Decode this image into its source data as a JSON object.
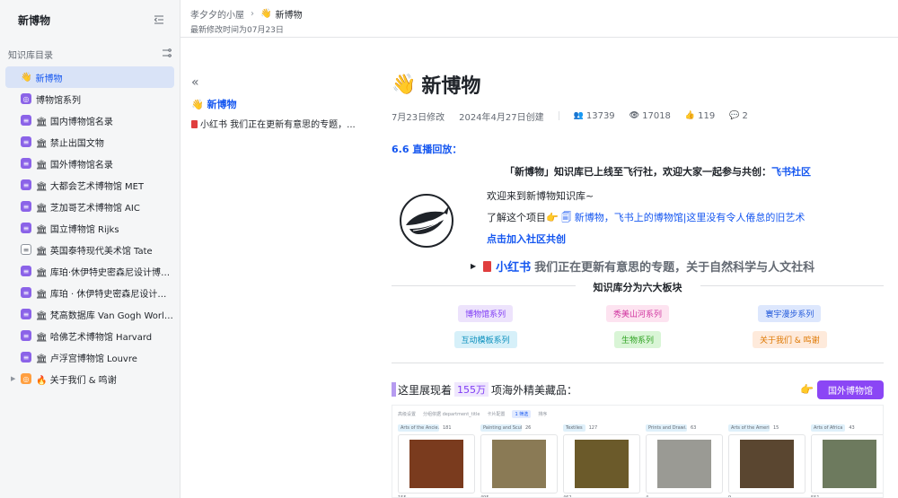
{
  "sidebar": {
    "title": "新博物",
    "section_label": "知识库目录",
    "items": [
      {
        "label": "新博物",
        "emoji": "👋",
        "icon": "wave-emoji",
        "active": true
      },
      {
        "label": "博物馆系列",
        "icon": "purple-badge-icon",
        "icon_text": "◎"
      },
      {
        "label": "🏛 国内博物馆名录",
        "icon": "purple-list-icon",
        "icon_text": "≡"
      },
      {
        "label": "🏛 禁止出国文物",
        "icon": "purple-list-icon",
        "icon_text": "≡"
      },
      {
        "label": "🏛 国外博物馆名录",
        "icon": "purple-list-icon",
        "icon_text": "≡"
      },
      {
        "label": "🏛 大都会艺术博物馆 MET",
        "icon": "purple-list-icon",
        "icon_text": "≡"
      },
      {
        "label": "🏛 芝加哥艺术博物馆 AIC",
        "icon": "purple-list-icon",
        "icon_text": "≡"
      },
      {
        "label": "🏛 国立博物馆 Rijks",
        "icon": "purple-list-icon",
        "icon_text": "≡"
      },
      {
        "label": "🏛 英国泰特现代美术馆 Tate",
        "icon": "grey-doc-icon",
        "icon_text": "≡"
      },
      {
        "label": "🏛 库珀·休伊特史密森尼设计博物...",
        "icon": "purple-list-icon",
        "icon_text": "≡"
      },
      {
        "label": "🏛 库珀 · 休伊特史密森尼设计博物...",
        "icon": "purple-list-icon",
        "icon_text": "≡"
      },
      {
        "label": "🏛 梵高数据库 Van Gogh Worldwide",
        "icon": "purple-list-icon",
        "icon_text": "≡"
      },
      {
        "label": "🏛 哈佛艺术博物馆 Harvard",
        "icon": "purple-list-icon",
        "icon_text": "≡"
      },
      {
        "label": "🏛 卢浮宫博物馆 Louvre",
        "icon": "purple-list-icon",
        "icon_text": "≡"
      },
      {
        "label": "🔥 关于我们 & 鸣谢",
        "icon": "orange-badge-icon",
        "icon_text": "◎",
        "collapsed": true
      }
    ]
  },
  "header": {
    "breadcrumb_parent": "孝夕夕的小屋",
    "breadcrumb_current_emoji": "👋",
    "breadcrumb_current": "新博物",
    "updated": "最新修改时间为07月23日"
  },
  "outline": {
    "toggle": "«",
    "items": [
      "👋 新博物",
      "小红书 我们正在更新有意思的专题，..."
    ]
  },
  "doc": {
    "title_emoji": "👋",
    "title": "新博物",
    "meta": {
      "modified": "7月23日修改",
      "created": "2024年4月27日创建",
      "users": "13739",
      "views": "17018",
      "likes": "119",
      "comments": "2"
    },
    "live": "6.6 直播回放：",
    "announce": "「新博物」知识库已上线至飞行社，欢迎大家一起参与共创：",
    "announce_link": "飞书社区",
    "welcome": "欢迎来到新博物知识库~",
    "learn_prefix": "了解这个项目👉",
    "learn_link": "新博物，飞书上的博物馆|这里没有令人倦怠的旧艺术",
    "join": "点击加入社区共创",
    "xhs_label": "小红书",
    "xhs_text": "我们正在更新有意思的专题，关于自然科学与人文社科",
    "six_title": "知识库分为六大板块",
    "tags": [
      "博物馆系列",
      "秀美山河系列",
      "寰宇漫步系列",
      "互动模板系列",
      "生物系列",
      "关于我们 & 鸣谢"
    ],
    "showcase_prefix": "这里展现着",
    "showcase_num": "155万",
    "showcase_suffix": "项海外精美藏品：",
    "showcase_emoji": "👉",
    "showcase_button": "国外博物馆"
  },
  "gallery": {
    "toolbar": [
      "高级设置",
      "分组依据 department_title",
      "卡片配置",
      "1 筛选",
      "排序"
    ],
    "columns": [
      {
        "name": "Arts of the Ancie...",
        "count": "181",
        "num": "155",
        "color": "#7a3b1e"
      },
      {
        "name": "Painting and Scul...",
        "count": "26",
        "num": "495",
        "color": "#8a7a55"
      },
      {
        "name": "Textiles",
        "count": "127",
        "num": "462",
        "color": "#6b5a2a"
      },
      {
        "name": "Prints and Drawi...",
        "count": "63",
        "num": "4",
        "color": "#9a9a94"
      },
      {
        "name": "Arts of the Ameri...",
        "count": "15",
        "num": "9",
        "color": "#5a4630"
      },
      {
        "name": "Arts of Africa",
        "count": "43",
        "num": "551",
        "color": "#6d7a5e"
      }
    ]
  },
  "colors": {
    "accent": "#1456f0",
    "purple": "#8b46f5",
    "active_bg": "#d9e3f7"
  }
}
